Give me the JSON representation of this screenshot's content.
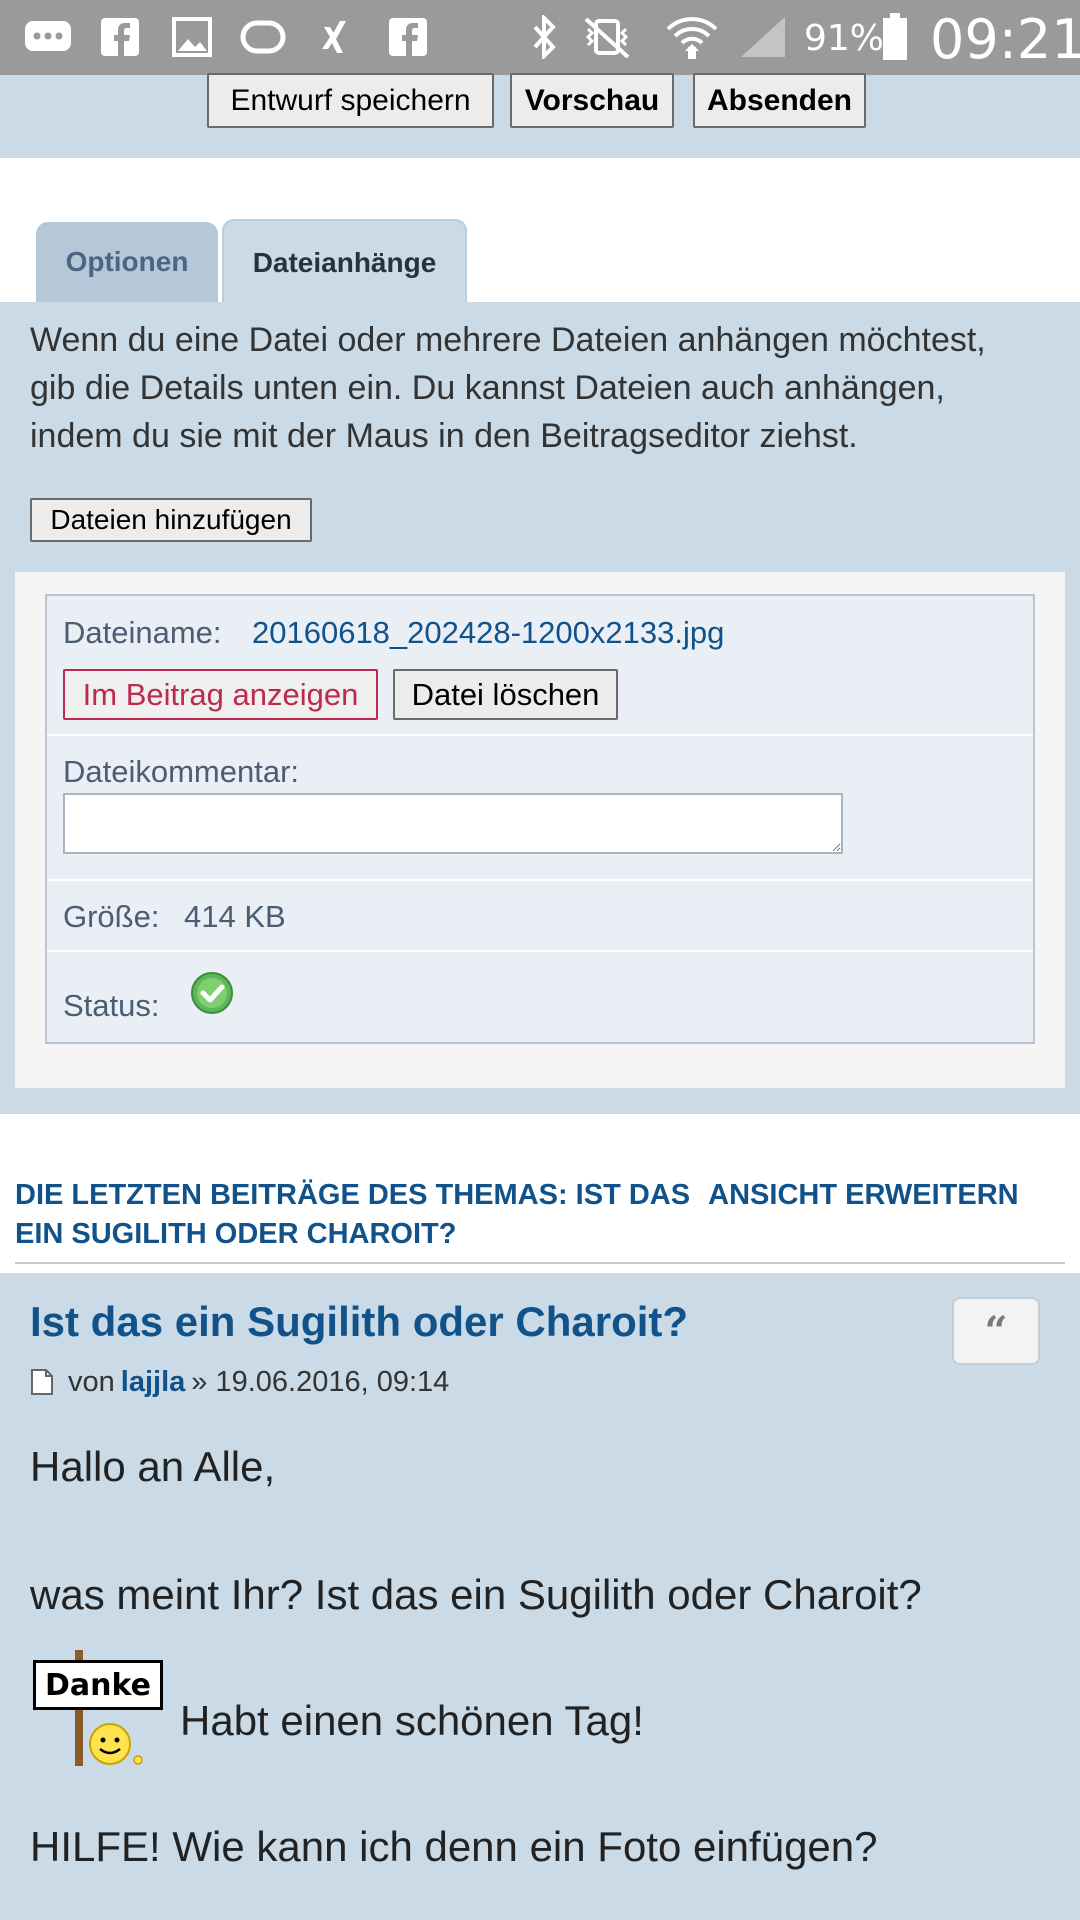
{
  "status_bar": {
    "icons": [
      "chat-bubble-icon",
      "facebook-icon",
      "image-icon",
      "loop-icon",
      "xing-icon",
      "facebook-icon",
      "bluetooth-icon",
      "vibrate-mute-icon",
      "wifi-icon",
      "signal-icon",
      "battery-icon"
    ],
    "battery": "91%",
    "time": "09:21"
  },
  "toolbar": {
    "save_draft": "Entwurf speichern",
    "preview": "Vorschau",
    "submit": "Absenden"
  },
  "tabs": [
    {
      "label": "Optionen",
      "active": false
    },
    {
      "label": "Dateianhänge",
      "active": true
    }
  ],
  "attachments": {
    "intro_lines": [
      "Wenn du eine Datei oder mehrere Dateien anhängen möchtest,",
      "gib die Details unten ein. Du kannst Dateien auch anhängen,",
      "indem du sie mit der Maus in den Beitragseditor ziehst."
    ],
    "add_files_button": "Dateien hinzufügen",
    "file": {
      "filename_label": "Dateiname:",
      "filename": "20160618_202428-1200x2133.jpg",
      "show_inline_button": "Im Beitrag anzeigen",
      "delete_button": "Datei löschen",
      "comment_label": "Dateikommentar:",
      "comment_value": "",
      "size_label": "Größe:",
      "size": "414 KB",
      "status_label": "Status:",
      "status_icon": "check-circle-icon"
    }
  },
  "recent_posts": {
    "heading_line1": "DIE LETZTEN BEITRÄGE DES THEMAS: IST DAS",
    "heading_line2": "EIN SUGILITH ODER CHAROIT?",
    "expand_link": "ANSICHT ERWEITERN",
    "post": {
      "title": "Ist das ein Sugilith oder Charoit?",
      "quote_symbol": "“",
      "by": "von",
      "author": "lajjla",
      "date": "» 19.06.2016, 09:14",
      "line1": "Hallo an Alle,",
      "line2": "was meint Ihr? Ist das ein Sugilith oder Charoit?",
      "smiley_sign": "Danke",
      "line3": "Habt einen schönen Tag!",
      "line4": "HILFE! Wie kann ich denn ein Foto einfügen?"
    }
  },
  "colors": {
    "panel_bg": "#cadae6",
    "link_blue": "#105289",
    "danger_red": "#bc2a4d",
    "status_bar": "#9a9a9a"
  }
}
